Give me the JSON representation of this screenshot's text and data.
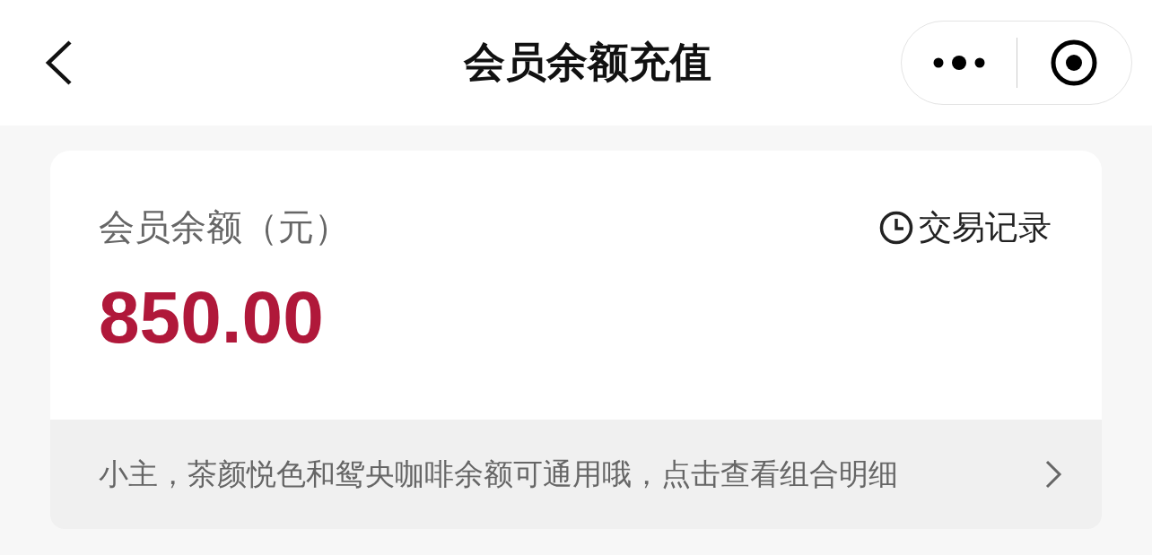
{
  "nav": {
    "title": "会员余额充值"
  },
  "balance_card": {
    "label": "会员余额（元）",
    "history_link": "交易记录",
    "amount": "850.00"
  },
  "notice": {
    "text": "小主，茶颜悦色和鸳央咖啡余额可通用哦，点击查看组合明细"
  }
}
